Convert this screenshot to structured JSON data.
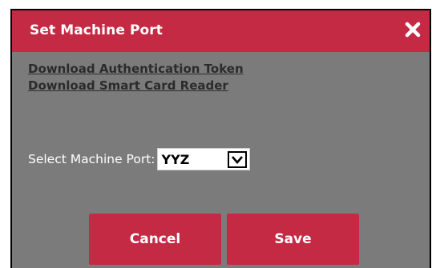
{
  "dialog": {
    "title": "Set Machine Port",
    "close_icon": "close-icon",
    "links": [
      {
        "label": "Download Authentication Token"
      },
      {
        "label": "Download Smart Card Reader"
      }
    ],
    "port": {
      "label": "Select Machine Port:",
      "selected": "YYZ",
      "dropdown_icon": "chevron-down-icon"
    },
    "buttons": {
      "cancel_label": "Cancel",
      "save_label": "Save"
    }
  },
  "colors": {
    "accent": "#c52a45",
    "body_bg": "#7b7b7b",
    "link": "#2b2b2b",
    "text_light": "#ffffff"
  }
}
